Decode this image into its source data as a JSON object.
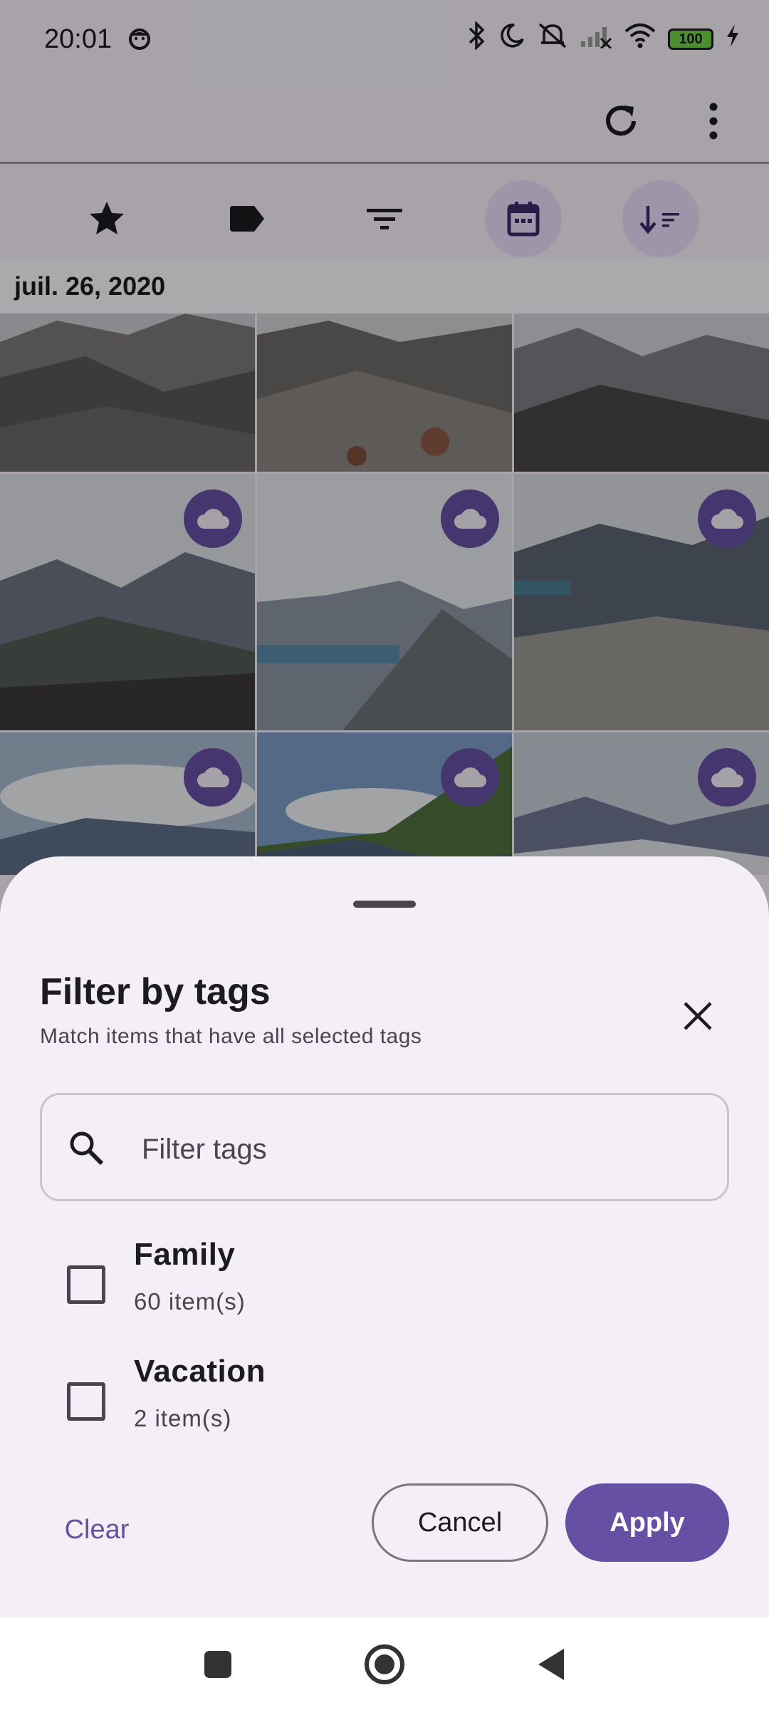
{
  "status_bar": {
    "time": "20:01",
    "battery": "100",
    "icons": [
      "face-icon",
      "bluetooth-icon",
      "moon-icon",
      "mute-icon",
      "signal-icon",
      "wifi-icon",
      "battery-icon",
      "charging-icon"
    ]
  },
  "top_bar": {
    "actions": [
      "refresh-icon",
      "more-vert-icon"
    ]
  },
  "toolbar": {
    "buttons": [
      "star-icon",
      "label-icon",
      "filter-icon",
      "calendar-icon",
      "sort-icon"
    ],
    "selected": [
      "calendar-icon",
      "sort-icon"
    ]
  },
  "gallery": {
    "date_header": "juil. 26, 2020",
    "photos": [
      {
        "cloud": false
      },
      {
        "cloud": false
      },
      {
        "cloud": false
      },
      {
        "cloud": true
      },
      {
        "cloud": true
      },
      {
        "cloud": true
      },
      {
        "cloud": true
      },
      {
        "cloud": true
      },
      {
        "cloud": true
      }
    ]
  },
  "sheet": {
    "title": "Filter by tags",
    "subtitle": "Match items that have all selected tags",
    "search_placeholder": "Filter tags",
    "tags": [
      {
        "name": "Family",
        "count": "60 item(s)",
        "checked": false
      },
      {
        "name": "Vacation",
        "count": "2 item(s)",
        "checked": false
      }
    ],
    "clear_label": "Clear",
    "cancel_label": "Cancel",
    "apply_label": "Apply"
  },
  "colors": {
    "accent": "#6750a4",
    "accent_container": "#e8def8",
    "sheet_bg": "#f4eff6"
  },
  "nav_bar": [
    "recents-icon",
    "home-icon",
    "back-icon"
  ]
}
